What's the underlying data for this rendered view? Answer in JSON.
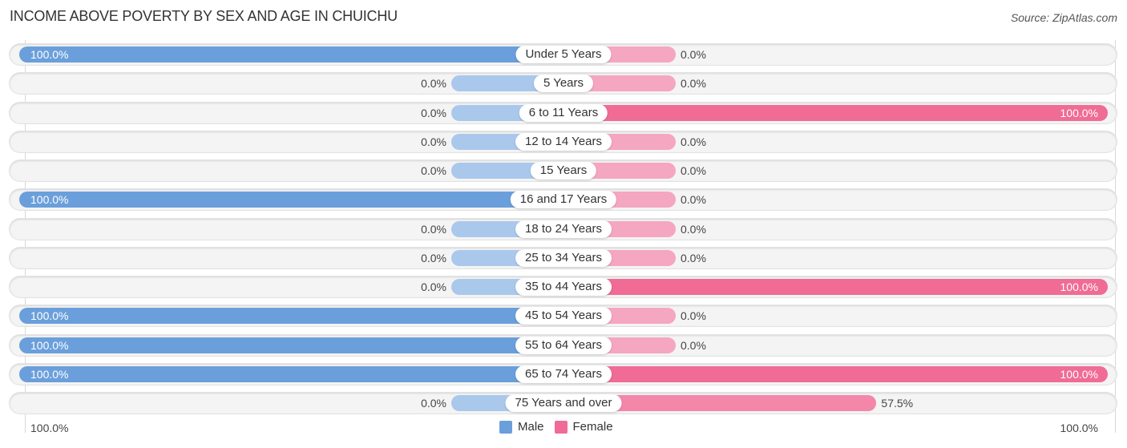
{
  "header": {
    "title": "INCOME ABOVE POVERTY BY SEX AND AGE IN CHUICHU",
    "source": "Source: ZipAtlas.com"
  },
  "colors": {
    "male": "#6a9fdb",
    "male_light": "#a9c8ec",
    "female": "#f06b96",
    "female_light": "#f5a6c1"
  },
  "chart_data": {
    "type": "bar",
    "orientation": "horizontal-diverging",
    "title": "INCOME ABOVE POVERTY BY SEX AND AGE IN CHUICHU",
    "categories": [
      "Under 5 Years",
      "5 Years",
      "6 to 11 Years",
      "12 to 14 Years",
      "15 Years",
      "16 and 17 Years",
      "18 to 24 Years",
      "25 to 34 Years",
      "35 to 44 Years",
      "45 to 54 Years",
      "55 to 64 Years",
      "65 to 74 Years",
      "75 Years and over"
    ],
    "series": [
      {
        "name": "Male",
        "values": [
          100.0,
          0.0,
          0.0,
          0.0,
          0.0,
          100.0,
          0.0,
          0.0,
          0.0,
          100.0,
          100.0,
          100.0,
          0.0
        ],
        "labels": [
          "100.0%",
          "0.0%",
          "0.0%",
          "0.0%",
          "0.0%",
          "100.0%",
          "0.0%",
          "0.0%",
          "0.0%",
          "100.0%",
          "100.0%",
          "100.0%",
          "0.0%"
        ]
      },
      {
        "name": "Female",
        "values": [
          0.0,
          0.0,
          100.0,
          0.0,
          0.0,
          0.0,
          0.0,
          0.0,
          100.0,
          0.0,
          0.0,
          100.0,
          57.5
        ],
        "labels": [
          "0.0%",
          "0.0%",
          "100.0%",
          "0.0%",
          "0.0%",
          "0.0%",
          "0.0%",
          "0.0%",
          "100.0%",
          "0.0%",
          "0.0%",
          "100.0%",
          "57.5%"
        ]
      }
    ],
    "xlim": [
      -100,
      100
    ],
    "axis_labels": {
      "left": "100.0%",
      "right": "100.0%"
    },
    "legend": {
      "position": "bottom-center",
      "entries": [
        "Male",
        "Female"
      ]
    },
    "xlabel": "",
    "ylabel": ""
  }
}
